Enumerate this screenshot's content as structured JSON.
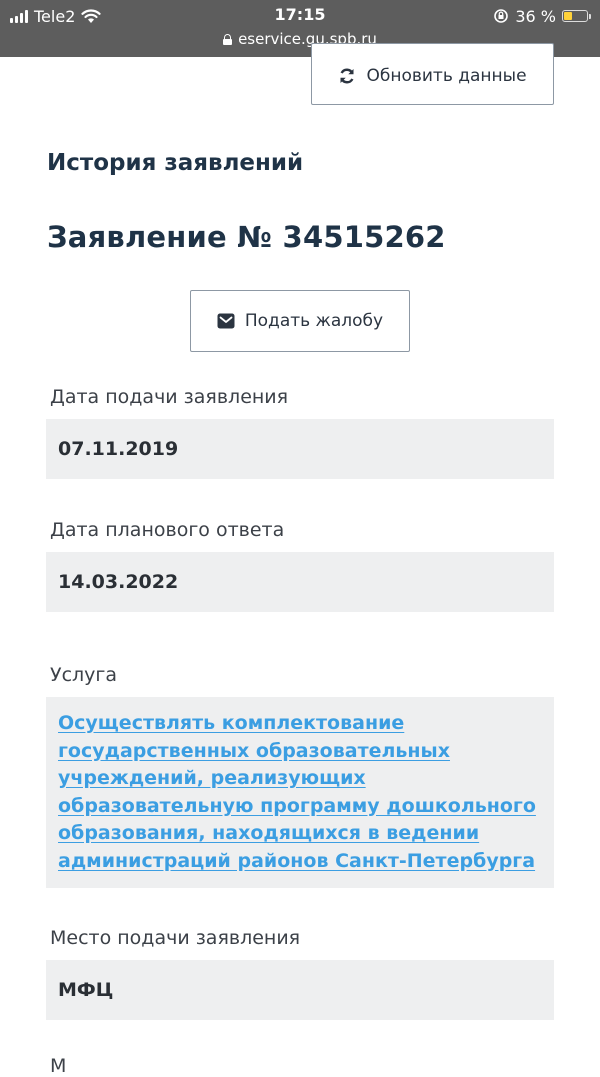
{
  "status_bar": {
    "carrier": "Tele2",
    "time": "17:15",
    "battery_percent": "36 %",
    "battery_level": 0.36,
    "url": "eservice.gu.spb.ru"
  },
  "toolbar": {
    "refresh_label": "Обновить данные"
  },
  "page": {
    "section_title": "История заявлений",
    "application_title": "Заявление № 34515262",
    "complaint_label": "Подать жалобу"
  },
  "fields": {
    "submission_date": {
      "label": "Дата подачи заявления",
      "value": "07.11.2019"
    },
    "planned_answer_date": {
      "label": "Дата планового ответа",
      "value": "14.03.2022"
    },
    "service": {
      "label": "Услуга",
      "value": "Осуществлять комплектование государственных образовательных учреждений, реализующих образовательную программу дошкольного образования, находящихся в ведении администраций районов Санкт-Петербурга"
    },
    "place": {
      "label": "Место подачи заявления",
      "value": "МФЦ"
    }
  },
  "cut_off_text": "М",
  "colors": {
    "status_bar_bg": "#5d5d5d",
    "heading": "#1f3347",
    "link": "#3b9ee2",
    "field_bg": "#eeeff0",
    "battery": "#ffd23a"
  },
  "icons": [
    "signal-icon",
    "wifi-icon",
    "rotation-lock-icon",
    "battery-icon",
    "lock-icon",
    "refresh-icon",
    "envelope-icon"
  ]
}
